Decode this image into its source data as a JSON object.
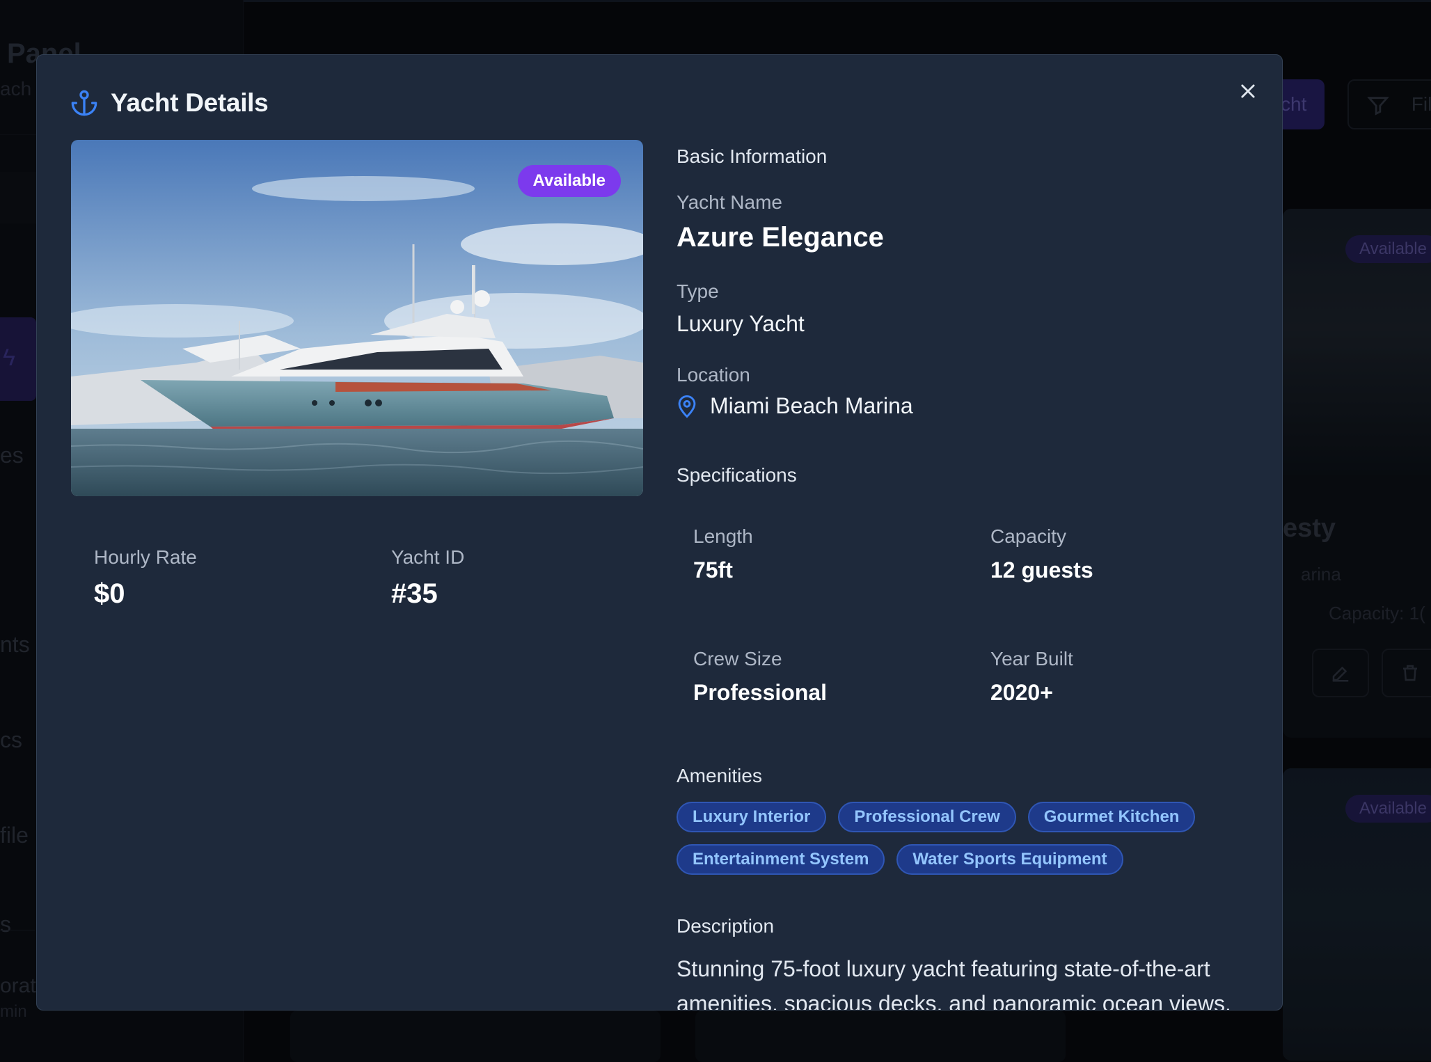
{
  "background": {
    "sidebar": {
      "title": "Panel",
      "subtitle": "ach",
      "items": [
        "es",
        "nts",
        "cs",
        "file",
        "s"
      ],
      "footer_name": "orati",
      "footer_role": "min"
    },
    "add_button_label": "cht",
    "filter_button_label": "Fil",
    "cards": [
      {
        "badge": "Available",
        "title": "esty",
        "location": "arina",
        "capacity": "Capacity: 1("
      },
      {
        "badge": "Available"
      }
    ]
  },
  "modal": {
    "title": "Yacht Details",
    "icon": "anchor-icon",
    "close_icon": "close-icon",
    "status_badge": "Available",
    "stats": {
      "hourly_rate_label": "Hourly Rate",
      "hourly_rate_value": "$0",
      "yacht_id_label": "Yacht ID",
      "yacht_id_value": "#35"
    },
    "basic_info": {
      "section_title": "Basic Information",
      "name_label": "Yacht Name",
      "name_value": "Azure Elegance",
      "type_label": "Type",
      "type_value": "Luxury Yacht",
      "location_label": "Location",
      "location_value": "Miami Beach Marina"
    },
    "specifications": {
      "section_title": "Specifications",
      "length_label": "Length",
      "length_value": "75ft",
      "capacity_label": "Capacity",
      "capacity_value": "12 guests",
      "crew_label": "Crew Size",
      "crew_value": "Professional",
      "year_label": "Year Built",
      "year_value": "2020+"
    },
    "amenities": {
      "section_title": "Amenities",
      "items": [
        "Luxury Interior",
        "Professional Crew",
        "Gourmet Kitchen",
        "Entertainment System",
        "Water Sports Equipment"
      ]
    },
    "description": {
      "section_title": "Description",
      "text": "Stunning 75-foot luxury yacht featuring state-of-the-art amenities, spacious decks, and panoramic ocean views."
    }
  },
  "colors": {
    "modal_bg": "#1e293b",
    "accent_purple": "#7c3aed",
    "chip_bg": "#1e3a8a",
    "chip_text": "#93c5fd",
    "icon_blue": "#3b82f6"
  }
}
